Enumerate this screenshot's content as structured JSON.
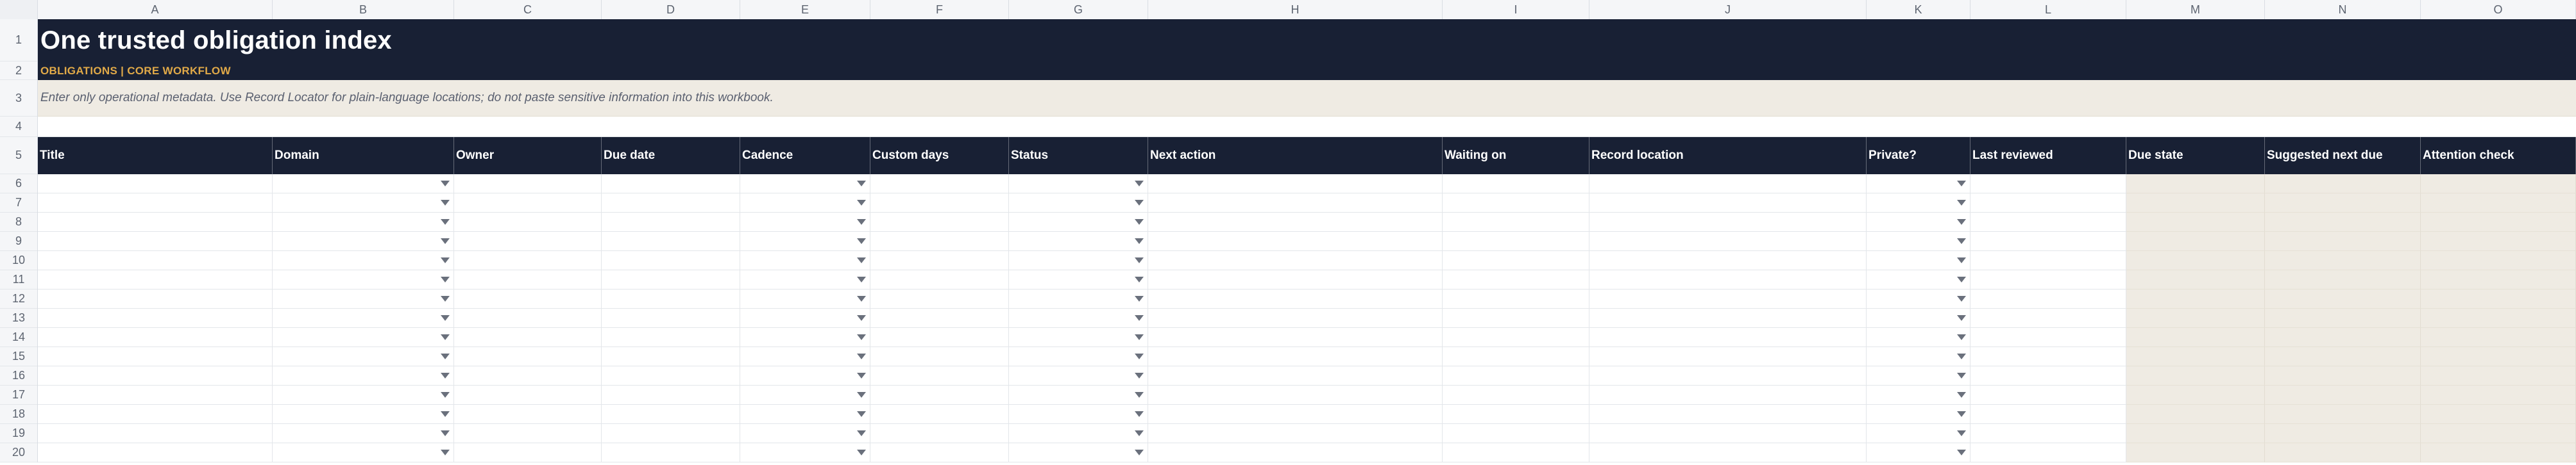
{
  "sheet": {
    "columns": [
      "A",
      "B",
      "C",
      "D",
      "E",
      "F",
      "G",
      "H",
      "I",
      "J",
      "K",
      "L",
      "M",
      "N",
      "O"
    ],
    "title": "One trusted obligation index",
    "subtitle": "OBLIGATIONS | CORE WORKFLOW",
    "note": "Enter only operational metadata. Use Record Locator for plain-language locations; do not paste sensitive information into this workbook.",
    "headers": [
      "Title",
      "Domain",
      "Owner",
      "Due date",
      "Cadence",
      "Custom days",
      "Status",
      "Next action",
      "Waiting on",
      "Record location",
      "Private?",
      "Last reviewed",
      "Due state",
      "Suggested next due",
      "Attention check"
    ],
    "dropdown_columns": [
      "B",
      "E",
      "G",
      "K"
    ],
    "computed_columns": [
      "M",
      "N",
      "O"
    ],
    "row_numbers": [
      "1",
      "2",
      "3",
      "4",
      "5",
      "6",
      "7",
      "8",
      "9",
      "10",
      "11",
      "12",
      "13",
      "14",
      "15",
      "16",
      "17",
      "18",
      "19",
      "20"
    ]
  },
  "colors": {
    "header_bg": "#182034",
    "subtitle_accent": "#e0a948",
    "note_bg": "#efebe3",
    "computed_bg": "#efebe3"
  },
  "icons": {
    "dropdown": "chevron-down-icon"
  }
}
